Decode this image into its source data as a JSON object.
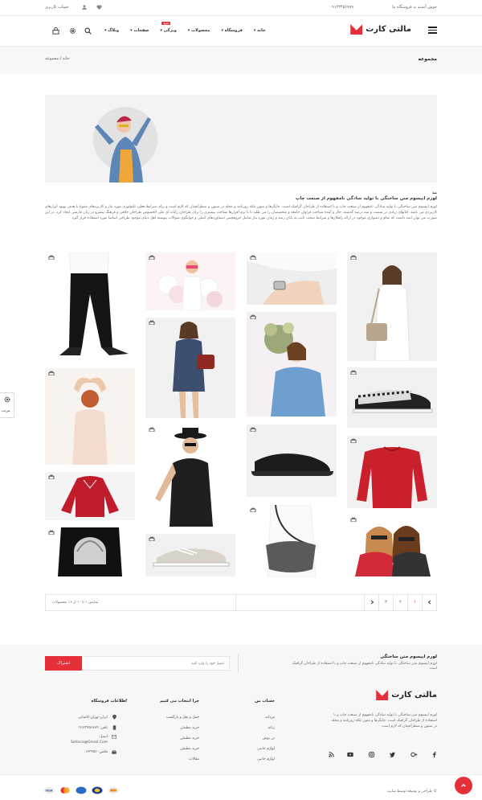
{
  "topbar": {
    "welcome": "خوش آمدید به فروشگاه ما",
    "phone": "۰۹۱۲۳۴۵۶۷۸۹",
    "account": "حساب کاربری",
    "wishlist_icon": "heart-icon",
    "user_icon": "user-icon"
  },
  "header": {
    "brand": "مالتی کارت",
    "menu_icon": "hamburger-icon",
    "nav": [
      "خانه",
      "فروشگاه",
      "محصولات",
      "ویژگی",
      "صفحات",
      "وبلاگ"
    ],
    "new_badge": "جدید",
    "icons": [
      "search-icon",
      "gear-icon",
      "cart-icon"
    ]
  },
  "breadcrumb": {
    "title": "مجموعه",
    "home": "خانه",
    "separator": "/",
    "current": "مجموعه"
  },
  "description": {
    "heading": "مد",
    "subheading": "لورم ایپسوم متن ساختگی با تولید سادگی نامفهوم از صنعت چاپ",
    "body": "لورم ایپسوم متن ساختگی با تولید سادگی نامفهوم از صنعت چاپ و با استفاده از طراحان گرافیک است. چاپگرها و متون بلکه روزنامه و مجله در ستون و سطرآنچنان که لازم است و برای شرایط فعلی تکنولوژی مورد نیاز و کاربردهای متنوع با هدف بهبود ابزارهای کاربردی می باشد. کتابهای زیادی در شصت و سه درصد گذشته، حال و آینده شناخت فراوان جامعه و متخصصان را می طلبد تا با نرم افزارها شناخت بیشتری را برای طراحان رایانه ای علی الخصوص طراحان خلاقی و فرهنگ پیشرو در زبان فارسی ایجاد کرد. در این صورت می توان امید داشت که تمام و دشواری موجود در ارائه راهکارها و شرایط سخت تایپ به پایان رسد و زمان مورد نیاز شامل حروفچینی دستاوردهای اصلی و جوابگوی سوالات پیوسته اهل دنیای موجود طراحی اساسا مورد استفاده قرار گیرد."
  },
  "products": [
    {
      "name": "product-red-sunglasses-girls",
      "kind": "photo"
    },
    {
      "name": "product-red-sweater",
      "kind": "photo"
    },
    {
      "name": "product-checkered-slip-on",
      "kind": "photo"
    },
    {
      "name": "product-woman-handbag",
      "kind": "photo"
    },
    {
      "name": "product-shoulder-bag",
      "kind": "photo"
    },
    {
      "name": "product-slide-sandal",
      "kind": "photo"
    },
    {
      "name": "product-blue-sweater",
      "kind": "photo"
    },
    {
      "name": "product-watch",
      "kind": "photo"
    },
    {
      "name": "product-sneaker",
      "kind": "photo"
    },
    {
      "name": "product-man-hat",
      "kind": "photo"
    },
    {
      "name": "product-denim-dress",
      "kind": "photo"
    },
    {
      "name": "product-balloons",
      "kind": "photo"
    },
    {
      "name": "product-round-bag",
      "kind": "photo"
    },
    {
      "name": "product-red-blouse",
      "kind": "photo"
    },
    {
      "name": "product-woman-back",
      "kind": "photo"
    },
    {
      "name": "product-black-pants",
      "kind": "photo"
    }
  ],
  "pagination": {
    "info": "نمایش ۱ تا ۱۰ از ۱۶ محصولات",
    "pages": [
      "۱",
      "۲",
      "۳"
    ],
    "prev_icon": "chevron-left-icon",
    "next_icon": "chevron-right-icon"
  },
  "newsletter": {
    "title": "لورم ایپسوم متن ساختگی",
    "text": "لورم ایپسوم متن ساختگی با تولید سادگی نامفهوم از صنعت چاپ و با استفاده از طراحان گرافیک است",
    "placeholder": "ایمیل خود را وارد کنید",
    "button": "اشتراک"
  },
  "footer": {
    "brand": "مالتی کارت",
    "about": "لورم ایپسوم متن ساختگی با تولید سادگی نامفهوم از صنعت چاپ و با استفاده از طراحان گرافیک است. چاپگرها و متون بلکه روزنامه و مجله در ستون و سطرآنچنان که لازم است.",
    "social": [
      "facebook-icon",
      "google-plus-icon",
      "twitter-icon",
      "instagram-icon",
      "youtube-icon",
      "rss-icon"
    ],
    "col_account": {
      "title": "حساب من",
      "items": [
        "مردانه",
        "زنانه",
        "تن پوش",
        "لوازم جانبی",
        "لوازم جانبی"
      ]
    },
    "col_why": {
      "title": "چرا انتخاب می کنیم",
      "items": [
        "حمل و نقل و بازگشت",
        "خرید مطمئن",
        "خرید مطمئن",
        "خرید مطمئن",
        "مقالات"
      ]
    },
    "col_info": {
      "title": "اطلاعات فروشگاه",
      "items": [
        "ایران-تهران-کاشانی",
        "تلفن: ۰۹۱۲۳۴۵۶۷۸۹",
        "ایمیل:",
        "Setinco@Gmail.Com",
        "فکس: ۱۲۳۴۵۶"
      ]
    }
  },
  "bottombar": {
    "copyright": "© طراحی و توسعه توسط سایت",
    "payments": [
      "visa-icon",
      "mastercard-icon",
      "amex-icon",
      "paypal-icon",
      "discover-icon"
    ],
    "scroll_top_icon": "arrow-up-icon"
  },
  "sidepanel": {
    "label": "مرتب",
    "gear_icon": "gear-icon"
  },
  "colors": {
    "accent": "#e5303a",
    "text": "#333333",
    "light_bg": "#f7f7f7"
  }
}
